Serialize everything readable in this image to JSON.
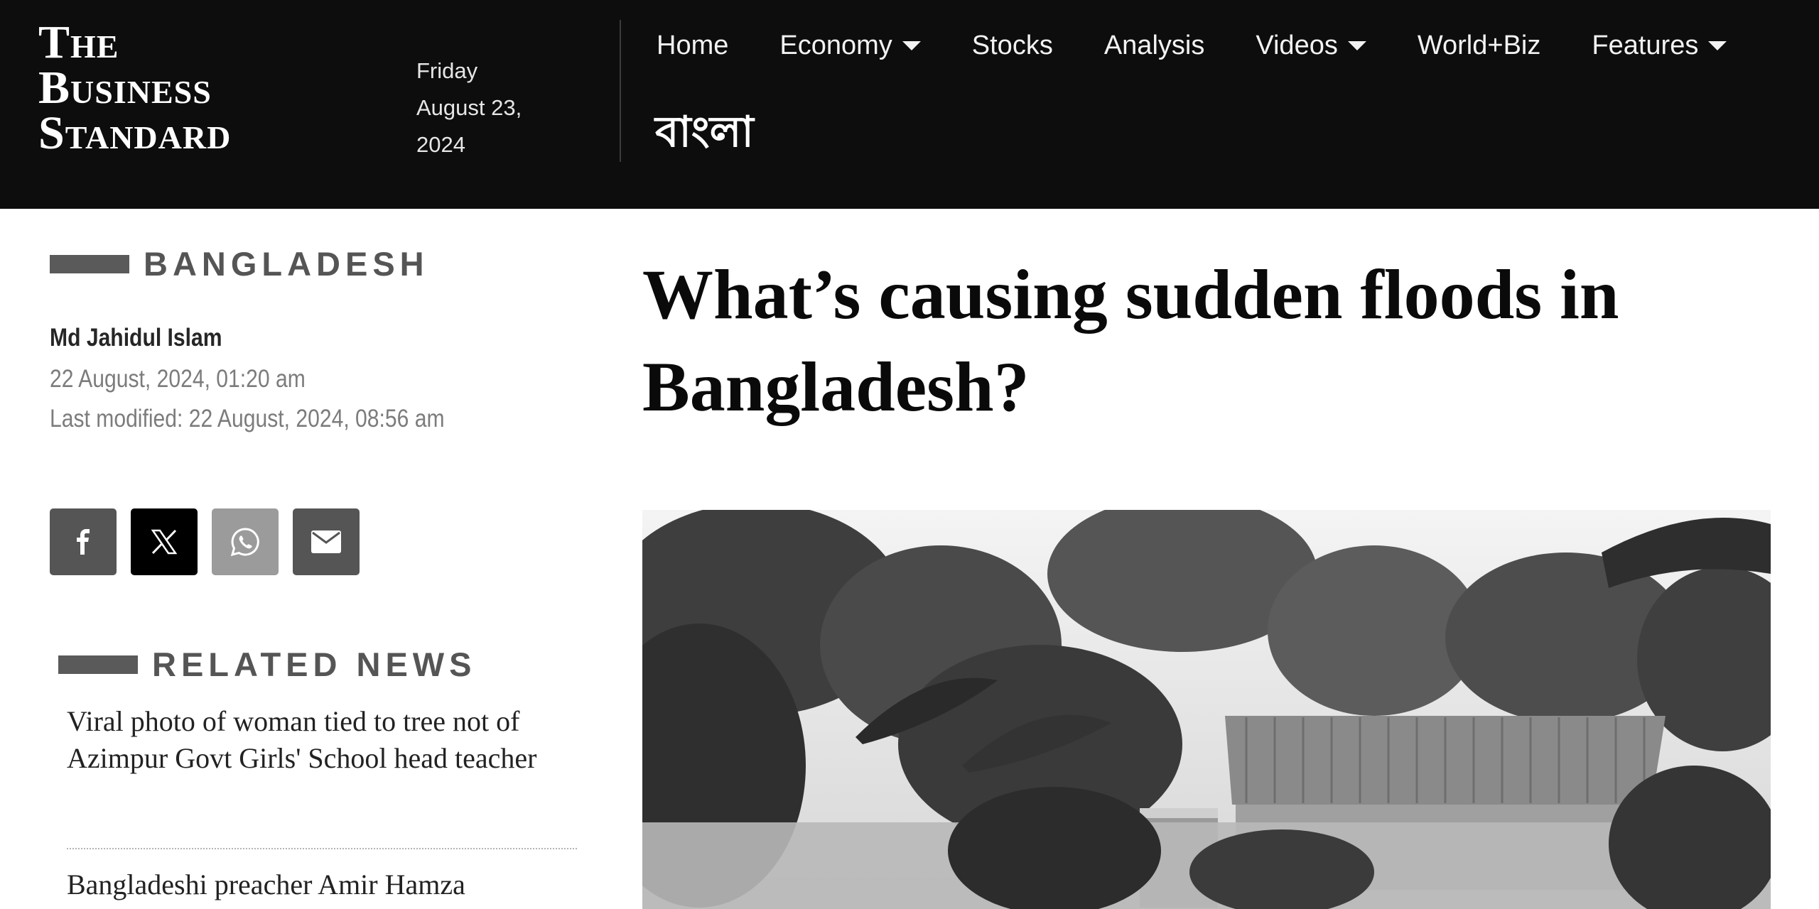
{
  "header": {
    "logo_line1": "The",
    "logo_line2": "Business",
    "logo_line3": "Standard",
    "date": {
      "weekday": "Friday",
      "month_day": "August 23,",
      "year": "2024"
    },
    "nav": [
      {
        "label": "Home",
        "has_dropdown": false
      },
      {
        "label": "Economy",
        "has_dropdown": true
      },
      {
        "label": "Stocks",
        "has_dropdown": false
      },
      {
        "label": "Analysis",
        "has_dropdown": false
      },
      {
        "label": "Videos",
        "has_dropdown": true
      },
      {
        "label": "World+Biz",
        "has_dropdown": false
      },
      {
        "label": "Features",
        "has_dropdown": true
      }
    ],
    "bangla_link": "বাংলা"
  },
  "article": {
    "category": "BANGLADESH",
    "author": "Md Jahidul Islam",
    "published": "22 August, 2024, 01:20 am",
    "last_modified": "Last modified: 22 August, 2024, 08:56 am",
    "headline": "What’s causing sudden floods in Bangladesh?"
  },
  "share": [
    {
      "network": "facebook",
      "icon": "facebook-icon"
    },
    {
      "network": "x",
      "icon": "x-icon"
    },
    {
      "network": "whatsapp",
      "icon": "whatsapp-icon"
    },
    {
      "network": "email",
      "icon": "mail-icon"
    }
  ],
  "related": {
    "title": "RELATED NEWS",
    "items": [
      "Viral photo of woman tied to tree not of Azimpur Govt Girls' School head teacher",
      "Bangladeshi preacher Amir Hamza"
    ]
  },
  "colors": {
    "header_bg": "#0d0d0d",
    "section_bar": "#5a5a5a",
    "meta_text": "#7c7c7c"
  }
}
